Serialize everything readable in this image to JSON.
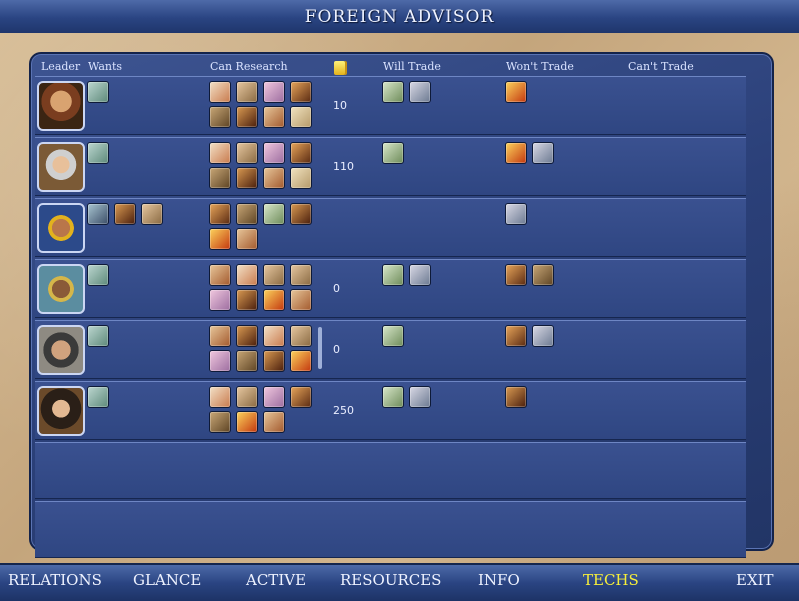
{
  "window": {
    "title": "FOREIGN ADVISOR"
  },
  "columns": {
    "leader": "Leader",
    "wants": "Wants",
    "can_research": "Can Research",
    "gold_icon": "gold-coins-icon",
    "will_trade": "Will Trade",
    "wont_trade": "Won't Trade",
    "cant_trade": "Can't Trade"
  },
  "rows": [
    {
      "gold": "10"
    },
    {
      "gold": "110"
    },
    {
      "gold": ""
    },
    {
      "gold": "0"
    },
    {
      "gold": "0"
    },
    {
      "gold": "250"
    }
  ],
  "tabs": [
    {
      "label": "RELATIONS"
    },
    {
      "label": "GLANCE"
    },
    {
      "label": "ACTIVE"
    },
    {
      "label": "RESOURCES"
    },
    {
      "label": "INFO"
    },
    {
      "label": "TECHS"
    },
    {
      "label": "EXIT"
    }
  ],
  "active_tab": "TECHS",
  "colors": {
    "active_tab": "#f7ef3a",
    "panel": "#2b4079",
    "titlebar": "#2a4482"
  }
}
